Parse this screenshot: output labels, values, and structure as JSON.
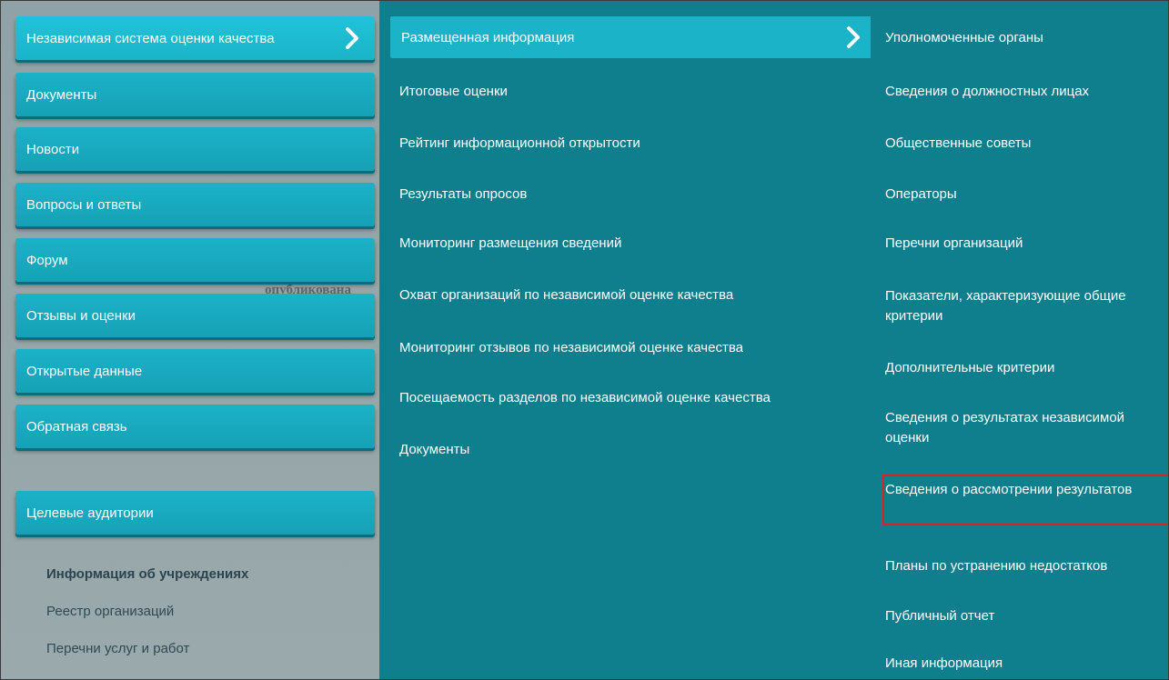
{
  "left_menu": {
    "buttons": [
      {
        "label": "Независимая система оценки качества",
        "active": true
      },
      {
        "label": "Документы"
      },
      {
        "label": "Новости"
      },
      {
        "label": "Вопросы и ответы"
      },
      {
        "label": "Форум"
      },
      {
        "label": "Отзывы и оценки"
      },
      {
        "label": "Открытые данные"
      },
      {
        "label": "Обратная связь"
      },
      {
        "label": "Целевые аудитории"
      }
    ],
    "links": [
      {
        "label": "Информация об учреждениях"
      },
      {
        "label": "Реестр организаций"
      },
      {
        "label": "Перечни услуг и работ"
      }
    ]
  },
  "middle_menu": {
    "active_label": "Размещенная информация",
    "items": [
      "Итоговые оценки",
      "Рейтинг информационной открытости",
      "Результаты опросов",
      "Мониторинг размещения сведений",
      "Охват организаций по независимой оценке качества",
      "Мониторинг отзывов по независимой оценке качества",
      "Посещаемость разделов по независимой оценке качества",
      "Документы"
    ]
  },
  "right_menu": {
    "items": [
      "Уполномоченные органы",
      "Сведения о должностных лицах",
      "Общественные советы",
      "Операторы",
      "Перечни организаций",
      "Показатели, характеризующие общие критерии",
      "Дополнительные критерии",
      "Сведения о результатах независимой оценки",
      "Сведения о рассмотрении результатов",
      "Планы по устранению недостатков",
      "Публичный отчет",
      "Иная информация"
    ],
    "highlighted_item": "Сведения о рассмотрении результатов",
    "highlight_color": "#e02020"
  },
  "colors": {
    "accent": "#1bb3c8",
    "panel": "#0f7f8e"
  },
  "icons": {
    "chevron": "chevron-right-icon"
  }
}
